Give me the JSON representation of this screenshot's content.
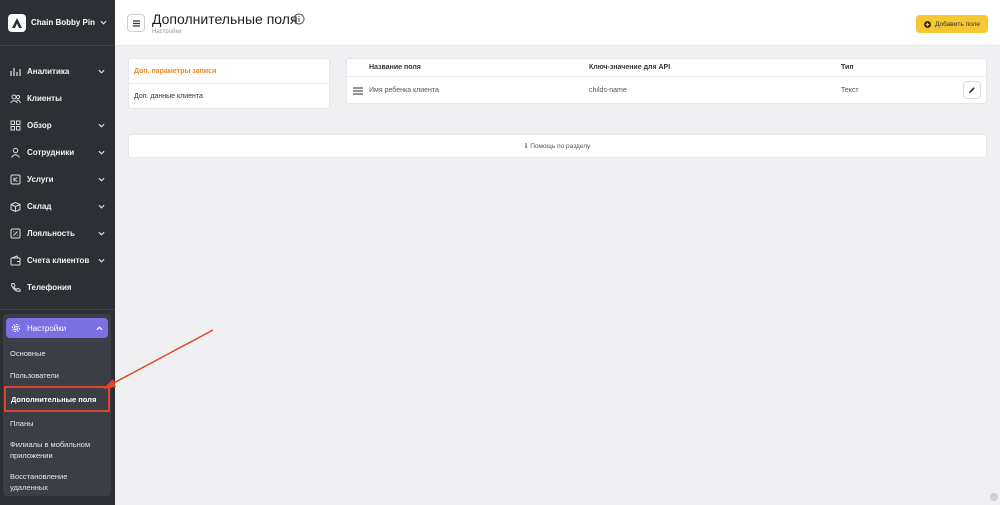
{
  "brand": {
    "name": "Chain Bobby Pin"
  },
  "menu": [
    {
      "label": "Аналитика",
      "icon": "chart-icon",
      "chevron": true
    },
    {
      "label": "Клиенты",
      "icon": "users-icon",
      "chevron": false
    },
    {
      "label": "Обзор",
      "icon": "grid-icon",
      "chevron": true
    },
    {
      "label": "Сотрудники",
      "icon": "person-icon",
      "chevron": true
    },
    {
      "label": "Услуги",
      "icon": "services-icon",
      "chevron": true
    },
    {
      "label": "Склад",
      "icon": "box-icon",
      "chevron": true
    },
    {
      "label": "Лояльность",
      "icon": "loyalty-icon",
      "chevron": true
    },
    {
      "label": "Счета клиентов",
      "icon": "wallet-icon",
      "chevron": true
    },
    {
      "label": "Телефония",
      "icon": "phone-icon",
      "chevron": false
    }
  ],
  "settings": {
    "label": "Настройки",
    "items": [
      {
        "label": "Основные"
      },
      {
        "label": "Пользователи"
      },
      {
        "label": "Дополнительные поля"
      },
      {
        "label": "Планы"
      },
      {
        "label": "Филиалы в мобильном приложении"
      },
      {
        "label": "Восстановление удаленных"
      }
    ],
    "active_index": 2
  },
  "header": {
    "title": "Дополнительные поля",
    "breadcrumb": "Настройки",
    "add_button": "Добавить поле"
  },
  "tabs": [
    {
      "label": "Доп. параметры записи",
      "active": true
    },
    {
      "label": "Доп. данные клиента",
      "active": false
    }
  ],
  "table": {
    "columns": [
      "Название поля",
      "Ключ-значение для API",
      "Тип"
    ],
    "rows": [
      {
        "name": "Имя ребенка клиента",
        "key": "childs-name",
        "type": "Текст"
      }
    ]
  },
  "help": {
    "icon": "ℹ",
    "label": "Помощь по разделу"
  },
  "colors": {
    "sidebar": "#2c3035",
    "settings_active": "#7b6fe3",
    "accent_button": "#f5c730",
    "active_tab": "#e78b2a",
    "annotation": "#e0442b"
  }
}
